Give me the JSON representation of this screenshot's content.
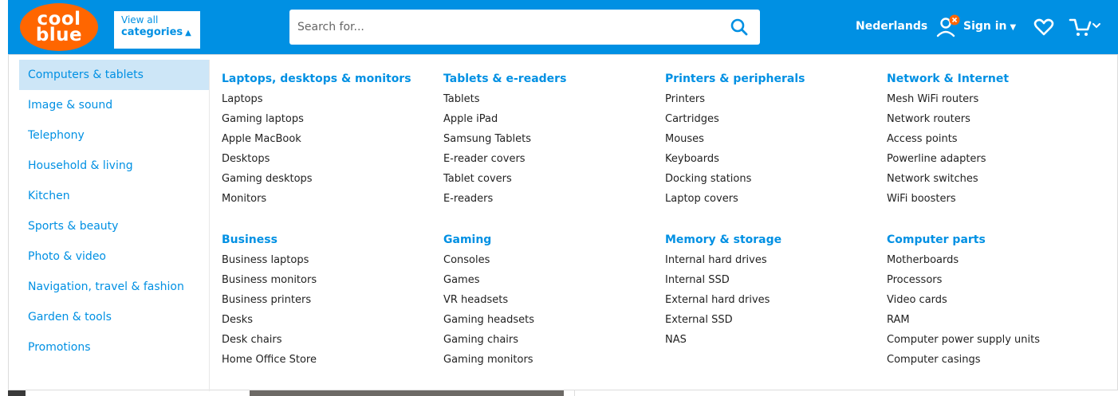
{
  "header": {
    "logo": {
      "line1": "cool",
      "line2": "blue"
    },
    "categories_button": {
      "line1": "View all",
      "line2": "categories",
      "icon": "chevron-up-icon"
    },
    "search": {
      "placeholder": "Search for...",
      "icon": "search-icon"
    },
    "language": "Nederlands",
    "signin": {
      "label": "Sign in",
      "icon": "user-icon",
      "badge_icon": "close-icon"
    },
    "wishlist_icon": "heart-icon",
    "cart_icon": "cart-icon",
    "colors": {
      "brand_blue": "#0090e3",
      "logo_orange": "#ff6600"
    }
  },
  "sidebar": {
    "items": [
      {
        "label": "Computers & tablets",
        "active": true
      },
      {
        "label": "Image & sound"
      },
      {
        "label": "Telephony"
      },
      {
        "label": "Household & living"
      },
      {
        "label": "Kitchen"
      },
      {
        "label": "Sports & beauty"
      },
      {
        "label": "Photo & video"
      },
      {
        "label": "Navigation, travel & fashion"
      },
      {
        "label": "Garden & tools"
      },
      {
        "label": "Promotions"
      }
    ]
  },
  "groups": [
    {
      "title": "Laptops, desktops & monitors",
      "links": [
        "Laptops",
        "Gaming laptops",
        "Apple MacBook",
        "Desktops",
        "Gaming desktops",
        "Monitors"
      ]
    },
    {
      "title": "Tablets & e-readers",
      "links": [
        "Tablets",
        "Apple iPad",
        "Samsung Tablets",
        "E-reader covers",
        "Tablet covers",
        "E-readers"
      ]
    },
    {
      "title": "Printers & peripherals",
      "links": [
        "Printers",
        "Cartridges",
        "Mouses",
        "Keyboards",
        "Docking stations",
        "Laptop covers"
      ]
    },
    {
      "title": "Network & Internet",
      "links": [
        "Mesh WiFi routers",
        "Network routers",
        "Access points",
        "Powerline adapters",
        "Network switches",
        "WiFi boosters"
      ]
    },
    {
      "title": "Business",
      "links": [
        "Business laptops",
        "Business monitors",
        "Business printers",
        "Desks",
        "Desk chairs",
        "Home Office Store"
      ]
    },
    {
      "title": "Gaming",
      "links": [
        "Consoles",
        "Games",
        "VR headsets",
        "Gaming headsets",
        "Gaming chairs",
        "Gaming monitors"
      ]
    },
    {
      "title": "Memory & storage",
      "links": [
        "Internal hard drives",
        "Internal SSD",
        "External hard drives",
        "External SSD",
        "NAS"
      ]
    },
    {
      "title": "Computer parts",
      "links": [
        "Motherboards",
        "Processors",
        "Video cards",
        "RAM",
        "Computer power supply units",
        "Computer casings"
      ]
    }
  ]
}
